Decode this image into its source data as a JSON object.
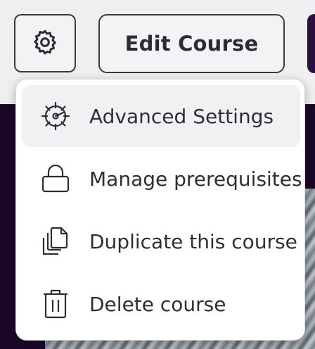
{
  "toolbar": {
    "settings_button_icon": "gear-icon",
    "edit_course_label": "Edit Course"
  },
  "menu": {
    "items": [
      {
        "label": "Advanced Settings",
        "icon": "advanced-settings-icon",
        "highlighted": true
      },
      {
        "label": "Manage prerequisites",
        "icon": "lock-icon",
        "highlighted": false
      },
      {
        "label": "Duplicate this course",
        "icon": "duplicate-icon",
        "highlighted": false
      },
      {
        "label": "Delete course",
        "icon": "trash-icon",
        "highlighted": false
      }
    ]
  },
  "colors": {
    "menu_highlight": "#f1f1f4",
    "backdrop": "#1b0726",
    "accent_purple": "#2a0f3f"
  }
}
